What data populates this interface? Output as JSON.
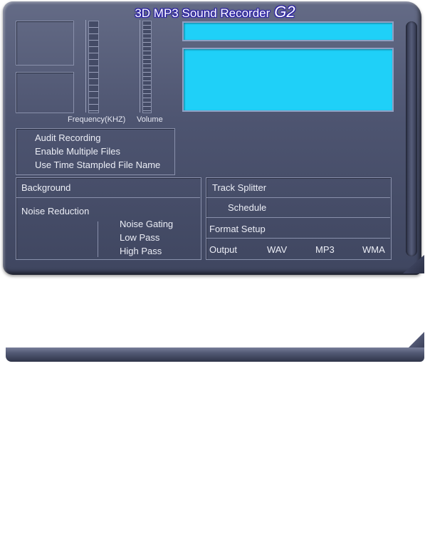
{
  "app": {
    "title": "3D MP3 Sound Recorder",
    "title_suffix": "G2"
  },
  "meters": {
    "frequency_label": "Frequency(KHZ)",
    "volume_label": "Volume"
  },
  "options": [
    {
      "label": "Audit Recording"
    },
    {
      "label": "Enable Multiple Files"
    },
    {
      "label": "Use Time Stampled File Name"
    }
  ],
  "background_panel": {
    "header": "Background",
    "noise_reduction": "Noise Reduction",
    "filters": [
      "Noise Gating",
      "Low Pass",
      "High Pass"
    ]
  },
  "track_panel": {
    "track_splitter": "Track Splitter",
    "schedule": "Schedule",
    "format_setup": "Format Setup",
    "output_label": "Output",
    "formats": [
      "WAV",
      "MP3",
      "WMA"
    ]
  },
  "colors": {
    "panel": "#4d5470",
    "lcd": "#1fd0f8",
    "title_glow": "#2a1fa8"
  }
}
